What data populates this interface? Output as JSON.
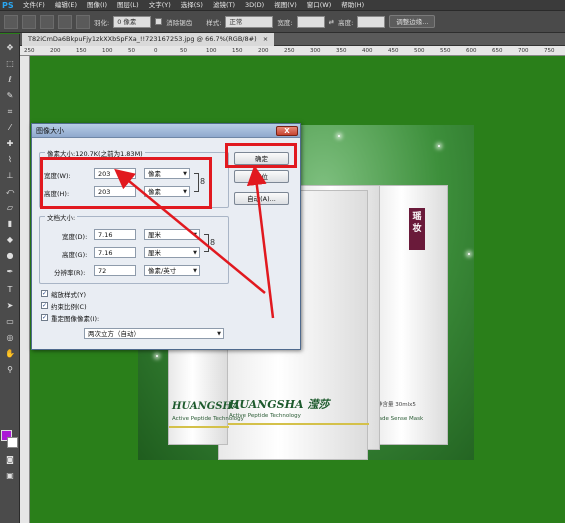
{
  "app": {
    "logo": "PS",
    "menus": [
      "文件(F)",
      "编辑(E)",
      "图像(I)",
      "图层(L)",
      "文字(Y)",
      "选择(S)",
      "滤镜(T)",
      "3D(D)",
      "视图(V)",
      "窗口(W)",
      "帮助(H)"
    ]
  },
  "options_bar": {
    "feather_label": "羽化:",
    "feather_value": "0 像素",
    "antialias_label": "消除锯齿",
    "style_label": "样式:",
    "style_value": "正常",
    "width_label": "宽度:",
    "height_label": "高度:",
    "refine_button": "调整边缘..."
  },
  "document": {
    "tab_title": "T82iCmDa6BkpuFjy1zkXXbSpFXa_!!723167253.jpg @ 66.7%(RGB/8#)",
    "close_glyph": "×",
    "ruler_ticks": [
      "250",
      "200",
      "150",
      "100",
      "50",
      "0",
      "50",
      "100",
      "150",
      "200",
      "250",
      "300",
      "350",
      "400",
      "450",
      "500",
      "550",
      "600",
      "650",
      "700",
      "750"
    ]
  },
  "product": {
    "brand_left": "HUANGSHA",
    "brand_main": "HUANGSHA 滢莎",
    "tagline": "Active Peptide Technology",
    "jade": "Jade Sense Mask",
    "small_cn": "净含量 30mlx5",
    "seal_text": "瑶妆"
  },
  "dialog": {
    "title": "图像大小",
    "close_glyph": "X",
    "pixel_dims_label": "像素大小:120.7K(之前为1.83M)",
    "width_label": "宽度(W):",
    "width_value": "203",
    "width_unit": "像素",
    "height_label": "高度(H):",
    "height_value": "203",
    "height_unit": "像素",
    "doc_size_label": "文档大小:",
    "doc_width_label": "宽度(D):",
    "doc_width_value": "7.16",
    "doc_width_unit": "厘米",
    "doc_height_label": "高度(G):",
    "doc_height_value": "7.16",
    "doc_height_unit": "厘米",
    "resolution_label": "分辨率(R):",
    "resolution_value": "72",
    "resolution_unit": "像素/英寸",
    "scale_styles_label": "缩放样式(Y)",
    "constrain_label": "约束比例(C)",
    "resample_label": "重定图像像素(I):",
    "resample_method": "两次立方（自动）",
    "ok_button": "确定",
    "reset_button": "复位",
    "auto_button": "自动(A)...",
    "check_glyph": "✓",
    "caret_glyph": "▼",
    "link_glyph": "8"
  }
}
